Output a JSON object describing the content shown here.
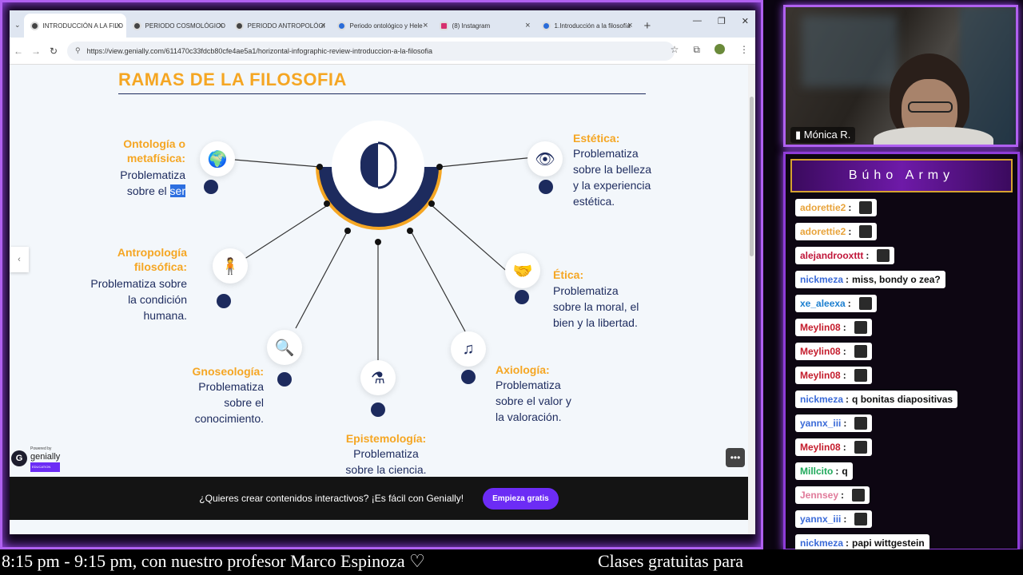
{
  "browser": {
    "tabs": [
      {
        "label": "INTRODUCCIÓN A LA FILO",
        "active": true
      },
      {
        "label": "PERIODO COSMOLÓGICO",
        "active": false
      },
      {
        "label": "PERIODO ANTROPOLÓGI",
        "active": false
      },
      {
        "label": "Periodo ontológico y Hele",
        "active": false
      },
      {
        "label": "(8) Instagram",
        "active": false
      },
      {
        "label": "1.Introducción a la filosofía",
        "active": false
      }
    ],
    "url": "https://view.genially.com/611470c33fdcb80cfe4ae5a1/horizontal-infographic-review-introduccion-a-la-filosofia"
  },
  "slide": {
    "title": "RAMAS DE LA FILOSOFIA",
    "branches": {
      "ontologia": {
        "title1": "Ontología o",
        "title2": "metafísica:",
        "d1": "Problematiza",
        "d2a": "sobre el ",
        "d2b": "ser"
      },
      "antropologia": {
        "title1": "Antropología",
        "title2": "filosófica:",
        "d1": "Problematiza sobre",
        "d2": "la condición",
        "d3": "humana."
      },
      "gnoseologia": {
        "title": "Gnoseología:",
        "d1": "Problematiza",
        "d2": "sobre el",
        "d3": "conocimiento."
      },
      "epistemologia": {
        "title": "Epistemología:",
        "d1": "Problematiza",
        "d2": "sobre la ciencia."
      },
      "axiologia": {
        "title": "Axiología:",
        "d1": "Problematiza",
        "d2": "sobre el valor y",
        "d3": "la valoración."
      },
      "etica": {
        "title": "Ética:",
        "d1": "Problematiza",
        "d2": "sobre la moral, el",
        "d3": "bien y la libertad."
      },
      "estetica": {
        "title": "Estética:",
        "d1": "Problematiza",
        "d2": "sobre la belleza",
        "d3": "y la experiencia",
        "d4": "estética."
      }
    }
  },
  "genially": {
    "powered_by": "Powered by",
    "brand": "genially",
    "edu": "EDUCATION",
    "banner_text": "¿Quieres crear contenidos interactivos? ¡Es fácil con Genially!",
    "cta": "Empieza gratis"
  },
  "stream": {
    "cam_name": "Mónica R.",
    "chat_title": "Búho Army",
    "bottom_left": "8:15 pm - 9:15 pm, con nuestro profesor Marco Espinoza ♡",
    "bottom_right": "Clases gratuitas para",
    "messages": [
      {
        "user": "adorettie2",
        "color": "#e8a33a",
        "text": ""
      },
      {
        "user": "adorettie2",
        "color": "#e8a33a",
        "text": ""
      },
      {
        "user": "alejandrooxttt",
        "color": "#c0163a",
        "text": ""
      },
      {
        "user": "nickmeza",
        "color": "#3a6ad8",
        "text": "miss, bondy o zea?"
      },
      {
        "user": "xe_aleexa",
        "color": "#1c7fd0",
        "text": ""
      },
      {
        "user": "Meylin08",
        "color": "#c41c2c",
        "text": ""
      },
      {
        "user": "Meylin08",
        "color": "#c41c2c",
        "text": ""
      },
      {
        "user": "Meylin08",
        "color": "#c41c2c",
        "text": ""
      },
      {
        "user": "nickmeza",
        "color": "#3a6ad8",
        "text": "q bonitas diapositivas"
      },
      {
        "user": "yannx_iii",
        "color": "#3a6ad8",
        "text": ""
      },
      {
        "user": "Meylin08",
        "color": "#c41c2c",
        "text": ""
      },
      {
        "user": "Millcito",
        "color": "#1fa85a",
        "text": "q"
      },
      {
        "user": "Jennsey",
        "color": "#e07a9a",
        "text": ""
      },
      {
        "user": "yannx_iii",
        "color": "#3a6ad8",
        "text": ""
      },
      {
        "user": "nickmeza",
        "color": "#3a6ad8",
        "text": "papi wittgestein"
      }
    ]
  }
}
